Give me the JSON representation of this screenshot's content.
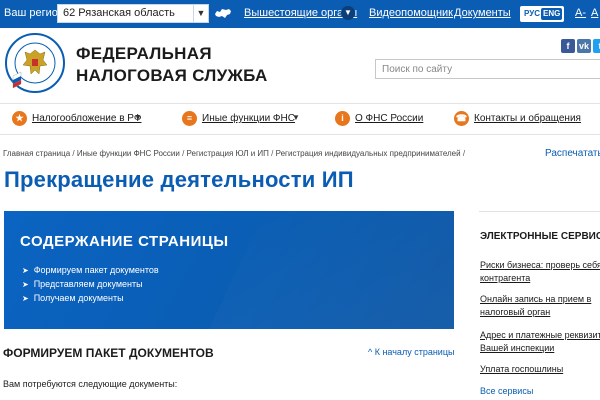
{
  "topbar": {
    "region_label": "Ваш регион",
    "region_value": "62 Рязанская область",
    "links": {
      "organs": "Вышестоящие органы",
      "video": "Видеопомощник",
      "docs": "Документы"
    },
    "lang_ru": "РУС",
    "lang_en": "ENG",
    "font_minus": "A-",
    "font_plus": "A"
  },
  "header": {
    "org_line1": "ФЕДЕРАЛЬНАЯ",
    "org_line2": "НАЛОГОВАЯ СЛУЖБА",
    "search_placeholder": "Поиск по сайту",
    "social": [
      "f",
      "vk",
      "t"
    ]
  },
  "nav": {
    "items": [
      {
        "label": "Налогообложение в РФ",
        "icon": "emblem-icon"
      },
      {
        "label": "Иные функции ФНС",
        "icon": "list-icon"
      },
      {
        "label": "О ФНС России",
        "icon": "info-icon"
      },
      {
        "label": "Контакты и обращения",
        "icon": "phone-icon"
      }
    ]
  },
  "breadcrumb": {
    "items": [
      "Главная страница",
      "Иные функции ФНС России",
      "Регистрация ЮЛ и ИП",
      "Регистрация индивидуальных предпринимателей"
    ],
    "separator": "/",
    "print": "Распечатать"
  },
  "page_title": "Прекращение деятельности ИП",
  "contents": {
    "title": "СОДЕРЖАНИЕ СТРАНИЦЫ",
    "items": [
      "Формируем пакет документов",
      "Представляем документы",
      "Получаем документы"
    ]
  },
  "section": {
    "heading": "ФОРМИРУЕМ ПАКЕТ ДОКУМЕНТОВ",
    "to_top": "^ К началу страницы",
    "lead": "Вам потребуются следующие документы:"
  },
  "sidebar": {
    "heading": "ЭЛЕКТРОННЫЕ СЕРВИСЫ",
    "links": [
      {
        "line1": "Риски бизнеса: проверь себя",
        "line2": "контрагента"
      },
      {
        "line1": "Онлайн запись на прием в",
        "line2": "налоговый орган"
      },
      {
        "line1": "Адрес и платежные реквизит",
        "line2": "Вашей инспекции"
      },
      {
        "line1": "Уплата госпошлины",
        "line2": ""
      }
    ],
    "all": "Все сервисы"
  },
  "colors": {
    "brand_blue": "#0a5db3",
    "accent_orange": "#e8761c"
  }
}
